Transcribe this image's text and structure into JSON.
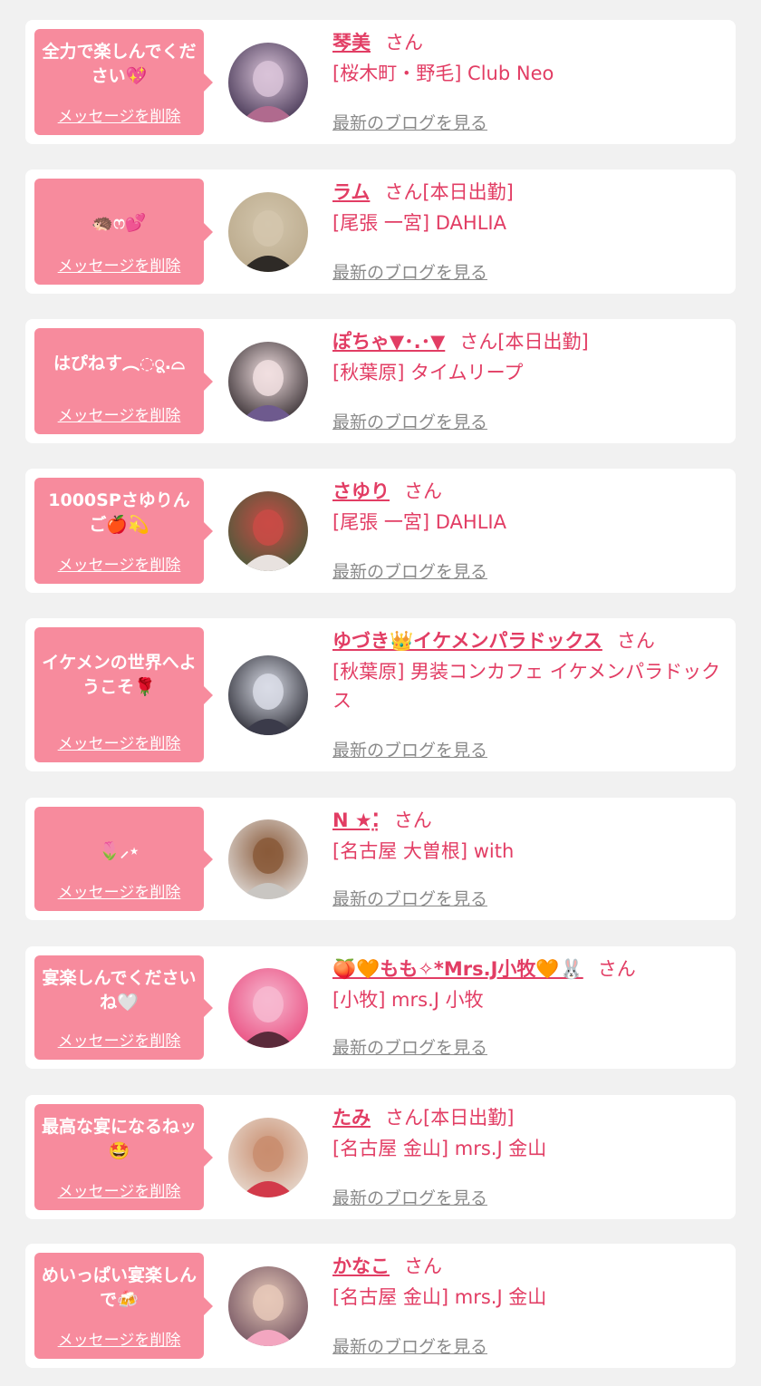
{
  "delete_label": "メッセージを削除",
  "blog_label": "最新のブログを見る",
  "san_label": "さん",
  "colors": {
    "background": "#f1f1f1",
    "bubble": "#f78b9d",
    "accent": "#e23d64",
    "link_gray": "#8a8a8a"
  },
  "messages": [
    {
      "message": "全力で楽しんでください💖",
      "name": "琴美",
      "suffix": "",
      "shop": "[桜木町・野毛] Club Neo",
      "avatar_colors": [
        "#3a2b4a",
        "#d9c3d8",
        "#b06a8e"
      ]
    },
    {
      "message": "🦔ෆ💕",
      "name": "ラム",
      "suffix": "[本日出勤]",
      "shop": "[尾張 一宮] DAHLIA",
      "avatar_colors": [
        "#b9a88a",
        "#d3c6ad",
        "#2e2a26"
      ]
    },
    {
      "message": "はぴねす︵◌ू.⌓",
      "name": "ぽちゃ▼･.･▼",
      "suffix": "[本日出勤]",
      "shop": "[秋葉原] タイムリープ",
      "avatar_colors": [
        "#2a2226",
        "#f1dfe0",
        "#6e5a8e"
      ]
    },
    {
      "message": "1000SPさゆりんご🍎💫",
      "name": "さゆり",
      "suffix": "",
      "shop": "[尾張 一宮] DAHLIA",
      "avatar_colors": [
        "#405c3a",
        "#c94b45",
        "#e8e2df"
      ]
    },
    {
      "message": "イケメンの世界へようこそ🌹",
      "name": "ゆづき👑イケメンパラドックス",
      "suffix": "",
      "shop": "[秋葉原] 男装コンカフェ イケメンパラドックス",
      "avatar_colors": [
        "#1f1f28",
        "#d9dce6",
        "#3b3b4a"
      ]
    },
    {
      "message": "🌷⸝⋆",
      "name": "N ★⁚̤",
      "suffix": "",
      "shop": "[名古屋 大曽根] with",
      "avatar_colors": [
        "#e4e2e0",
        "#8a5a3a",
        "#c9c6c2"
      ]
    },
    {
      "message": "宴楽しんでくださいね🤍",
      "name": "🍑🧡もも✧*Mrs.J小牧🧡🐰",
      "suffix": "",
      "shop": "[小牧] mrs.J 小牧",
      "avatar_colors": [
        "#e8467a",
        "#f7b8d0",
        "#5a2a3a"
      ]
    },
    {
      "message": "最高な宴になるねッ🤩",
      "name": "たみ",
      "suffix": "[本日出勤]",
      "shop": "[名古屋 金山] mrs.J 金山",
      "avatar_colors": [
        "#e9dfd6",
        "#c98d6e",
        "#d23a4a"
      ]
    },
    {
      "message": "めいっぱい宴楽しんで🍻",
      "name": "かなこ",
      "suffix": "",
      "shop": "[名古屋 金山] mrs.J 金山",
      "avatar_colors": [
        "#6a4a5a",
        "#e6c8b8",
        "#f3a6c0"
      ]
    }
  ]
}
